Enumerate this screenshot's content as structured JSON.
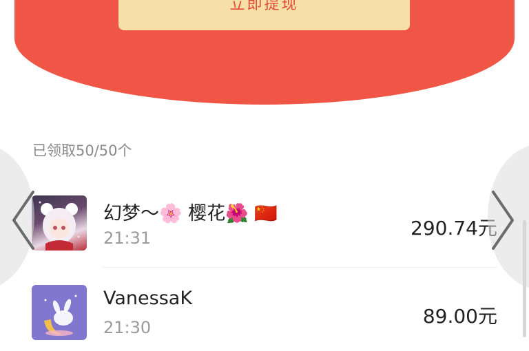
{
  "header": {
    "withdraw_label": "立即提现",
    "bg_color": "#f05646",
    "button_color": "#f7e0a8"
  },
  "summary": {
    "claimed_text": "已领取50/50个"
  },
  "records": [
    {
      "name": "幻梦～🌸 樱花🌺 🇨🇳",
      "time": "21:31",
      "amount": "290.74元",
      "avatar": "anime-girl-avatar"
    },
    {
      "name": "VanessaK",
      "time": "21:30",
      "amount": "89.00元",
      "avatar": "moon-bunny-avatar"
    }
  ],
  "nav": {
    "prev_icon": "chevron-left-icon",
    "next_icon": "chevron-right-icon"
  }
}
